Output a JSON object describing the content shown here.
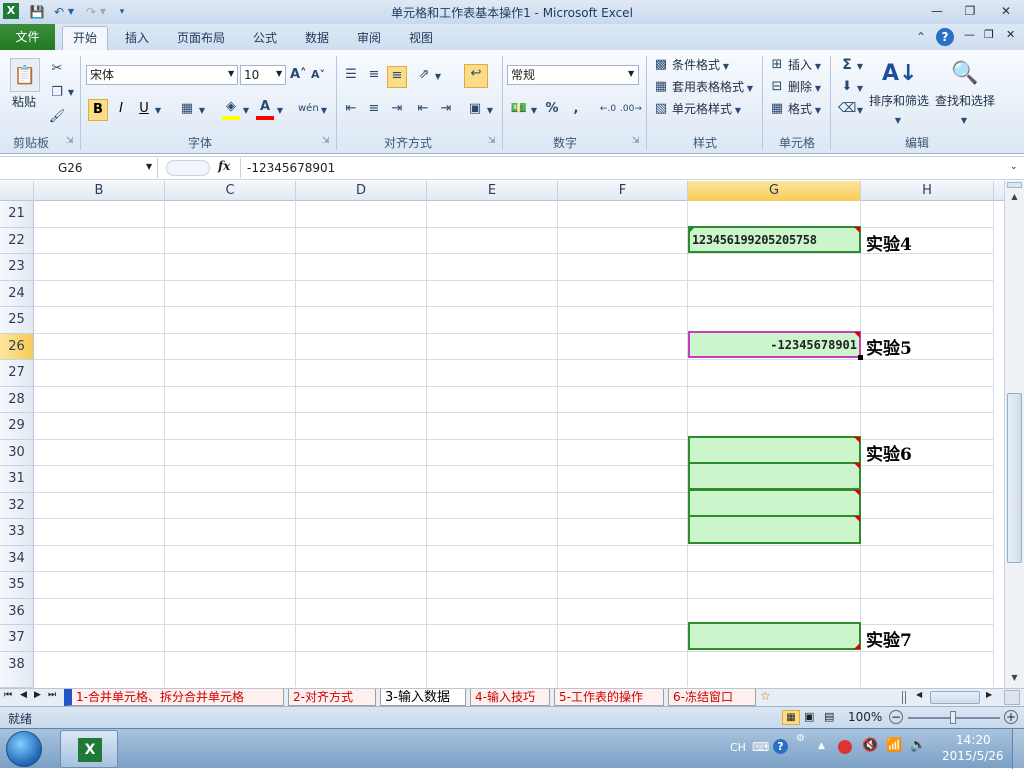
{
  "window": {
    "title": "单元格和工作表基本操作1 - Microsoft Excel"
  },
  "ribbon_tabs": [
    "文件",
    "开始",
    "插入",
    "页面布局",
    "公式",
    "数据",
    "审阅",
    "视图"
  ],
  "clipboard": {
    "paste": "粘贴",
    "group": "剪贴板"
  },
  "font": {
    "name": "宋体",
    "size": "10",
    "group": "字体",
    "bold": "B",
    "italic": "I",
    "underline": "U"
  },
  "alignment": {
    "group": "对齐方式"
  },
  "number": {
    "format": "常规",
    "group": "数字",
    "percent": "%",
    "comma": ","
  },
  "styles": {
    "conditional": "条件格式",
    "table": "套用表格格式",
    "cell": "单元格样式",
    "group": "样式"
  },
  "cells": {
    "insert": "插入",
    "delete": "删除",
    "format": "格式",
    "group": "单元格"
  },
  "editing": {
    "sort": "排序和筛选",
    "find": "查找和选择",
    "group": "编辑",
    "sigma": "Σ"
  },
  "formula_bar": {
    "name_box": "G26",
    "fx": "fx",
    "value": "-12345678901"
  },
  "columns": [
    "B",
    "C",
    "D",
    "E",
    "F",
    "G",
    "H"
  ],
  "rows": [
    "21",
    "22",
    "23",
    "24",
    "25",
    "26",
    "27",
    "28",
    "29",
    "30",
    "31",
    "32",
    "33",
    "34",
    "35",
    "36",
    "37",
    "38"
  ],
  "cells_content": {
    "g22": "123456199205205758",
    "g26": "-12345678901"
  },
  "labels": {
    "exp4": "实验4",
    "exp5": "实验5",
    "exp6": "实验6",
    "exp7": "实验7"
  },
  "sheet_tabs": [
    "1-合并单元格、拆分合并单元格",
    "2-对齐方式",
    "3-输入数据",
    "4-输入技巧",
    "5-工作表的操作",
    "6-冻结窗口"
  ],
  "active_sheet_index": 2,
  "status": {
    "ready": "就绪",
    "zoom": "100%"
  },
  "taskbar": {
    "lang": "CH",
    "time": "14:20",
    "date": "2015/5/26"
  }
}
